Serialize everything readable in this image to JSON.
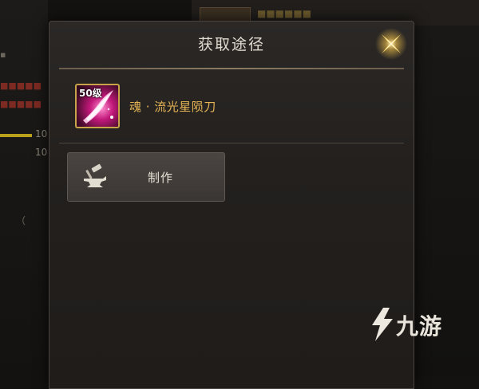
{
  "dialog": {
    "title": "获取途径",
    "item": {
      "level_badge": "50级",
      "name": "魂 · 流光星陨刀"
    },
    "source_button": {
      "label": "制作",
      "icon": "anvil-hammer-icon"
    },
    "close_icon": "close-x-icon"
  },
  "background": {
    "left_numbers": [
      "10",
      "10"
    ],
    "left_paren": "（"
  },
  "watermark": {
    "text": "九游",
    "logo": "jiuyou-logo-icon"
  },
  "colors": {
    "item_name": "#e5b455",
    "item_border": "#c9a34a",
    "dialog_bg": "#23201e",
    "button_bg": "#3f3b37"
  }
}
